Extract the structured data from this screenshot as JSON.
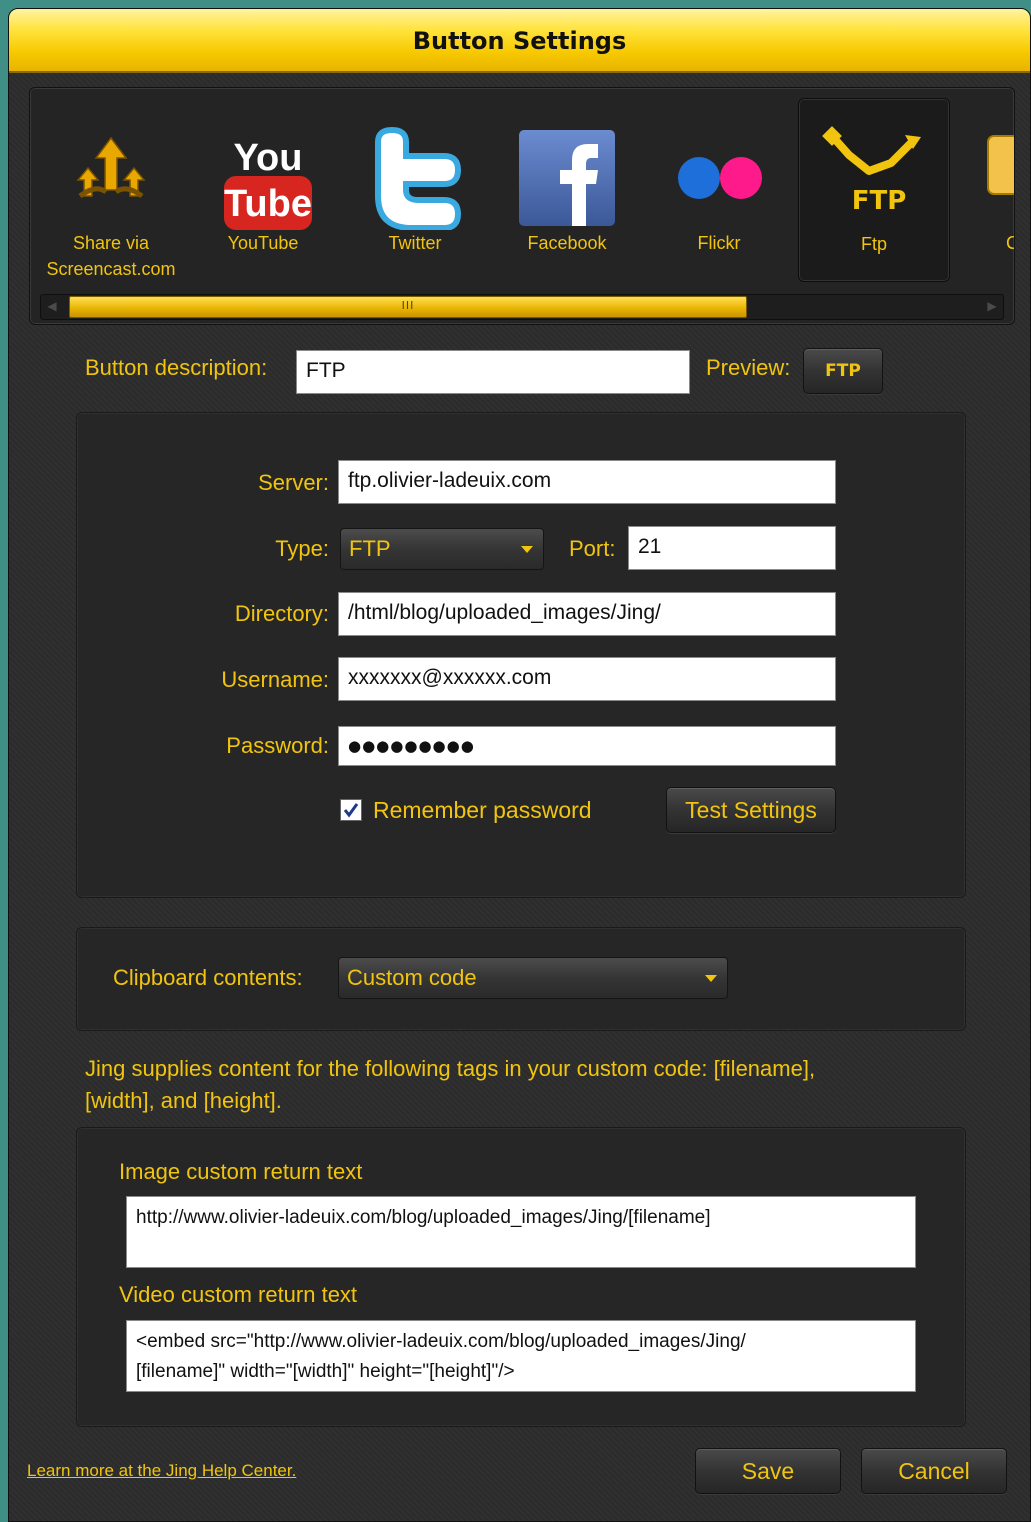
{
  "window": {
    "title": "Button Settings"
  },
  "buttons": [
    {
      "label": "Share via\nScreencast.com",
      "icon": "screencast-icon"
    },
    {
      "label": "YouTube",
      "icon": "youtube-icon"
    },
    {
      "label": "Twitter",
      "icon": "twitter-icon"
    },
    {
      "label": "Facebook",
      "icon": "facebook-icon"
    },
    {
      "label": "Flickr",
      "icon": "flickr-icon"
    },
    {
      "label": "Ftp",
      "icon": "ftp-icon",
      "selected": true
    },
    {
      "label": "C",
      "icon": "custom-icon"
    }
  ],
  "icon_text": {
    "youtube_you": "You",
    "youtube_tube": "Tube",
    "ftp": "FTP"
  },
  "scrollbar": {
    "grip": "III"
  },
  "description": {
    "label": "Button description:",
    "value": "FTP",
    "preview_label": "Preview:",
    "preview_button": "FTP"
  },
  "ftp": {
    "server_label": "Server:",
    "server": "ftp.olivier-ladeuix.com",
    "type_label": "Type:",
    "type": "FTP",
    "port_label": "Port:",
    "port": "21",
    "directory_label": "Directory:",
    "directory": "/html/blog/uploaded_images/Jing/",
    "username_label": "Username:",
    "username": "xxxxxxx@xxxxxx.com",
    "password_label": "Password:",
    "password": "●●●●●●●●●",
    "remember_label": "Remember password",
    "remember_checked": true,
    "test_button": "Test Settings"
  },
  "clipboard": {
    "label": "Clipboard contents:",
    "value": "Custom code"
  },
  "info_text": "Jing supplies content for the following tags in your custom code: [filename],\n[width], and [height].",
  "custom": {
    "image_label": "Image custom return text",
    "image_value": "http://www.olivier-ladeuix.com/blog/uploaded_images/Jing/[filename]",
    "video_label": "Video custom return text",
    "video_value": "<embed src=\"http://www.olivier-ladeuix.com/blog/uploaded_images/Jing/\n[filename]\" width=\"[width]\" height=\"[height]\"/>"
  },
  "footer": {
    "help_link": "Learn more at the Jing Help Center.",
    "save": "Save",
    "cancel": "Cancel"
  },
  "colors": {
    "accent": "#f1c40f",
    "background": "#2c2c2c",
    "titlebar": "#ffe23a"
  }
}
